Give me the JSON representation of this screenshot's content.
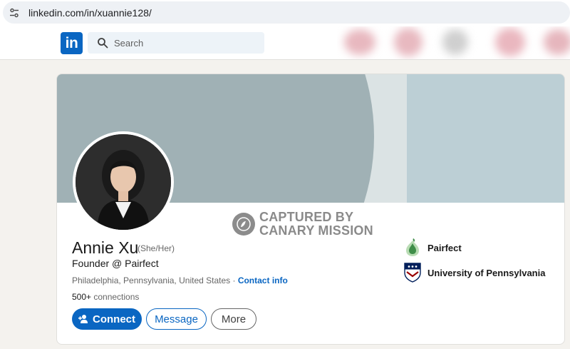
{
  "browser": {
    "url": "linkedin.com/in/xuannie128/",
    "site_controls_icon": "tune-icon"
  },
  "nav": {
    "logo_text": "in",
    "search": {
      "placeholder": "Search",
      "icon": "search-icon"
    },
    "brand_color": "#0a66c2"
  },
  "profile": {
    "name": "Annie Xu",
    "pronouns": "(She/Her)",
    "headline": "Founder @ Pairfect",
    "location": "Philadelphia, Pennsylvania, United States",
    "separator": " · ",
    "contact_link": "Contact info",
    "connections_count": "500+",
    "connections_label": " connections"
  },
  "actions": {
    "connect": "Connect",
    "message": "Message",
    "more": "More"
  },
  "organizations": [
    {
      "name": "Pairfect",
      "logo": "pairfect-logo"
    },
    {
      "name": "University of Pennsylvania",
      "logo": "penn-shield-logo"
    }
  ],
  "watermark": {
    "line1": "CAPTURED BY",
    "line2": "CANARY MISSION"
  }
}
